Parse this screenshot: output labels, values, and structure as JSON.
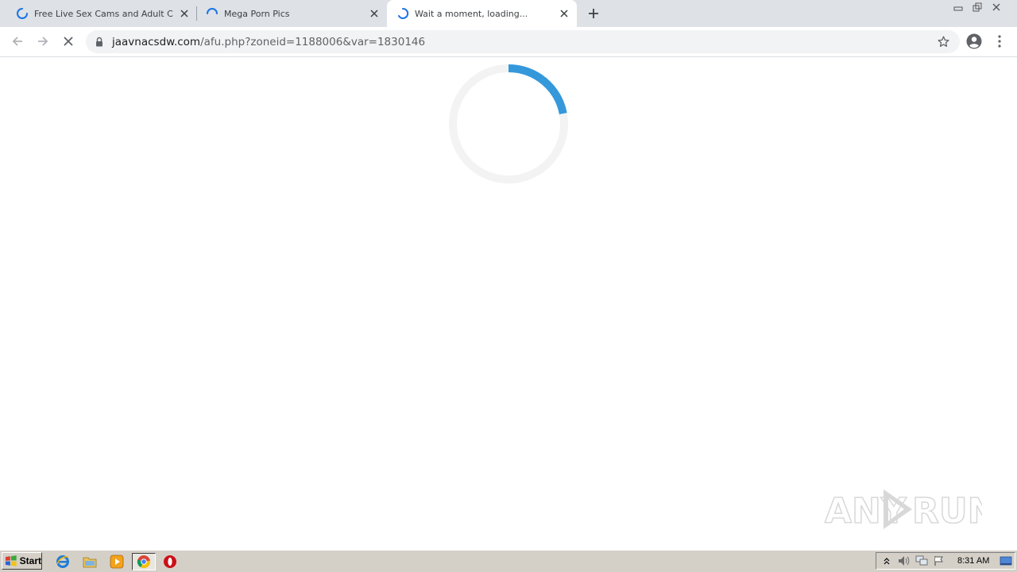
{
  "tabs": [
    {
      "title": "Free Live Sex Cams and Adult Chat ·",
      "state": "loading"
    },
    {
      "title": "Mega Porn Pics",
      "state": "loading"
    },
    {
      "title": "Wait a moment, loading...",
      "state": "loading",
      "active": true
    }
  ],
  "toolbar": {
    "url_host": "jaavnacsdw.com",
    "url_path": "/afu.php?zoneid=1188006&var=1830146",
    "back_icon": "arrow-left-icon",
    "forward_icon": "arrow-right-icon",
    "stop_icon": "close-icon",
    "lock_icon": "lock-icon",
    "bookmark_icon": "star-icon",
    "profile_icon": "account-circle-icon",
    "menu_icon": "more-vert-icon"
  },
  "page": {
    "loader_progress": 0.22,
    "loader_color": "#3498db",
    "loader_track_color": "#f3f3f3"
  },
  "watermark": {
    "text_left": "ANY",
    "text_right": "RUN"
  },
  "taskbar": {
    "start_label": "Start",
    "apps": [
      "internet-explorer-icon",
      "file-explorer-icon",
      "media-player-icon",
      "chrome-icon",
      "opera-icon"
    ],
    "clock": "8:31 AM"
  },
  "colors": {
    "tabstrip_bg": "#dee1e6",
    "accent_blue": "#1a73e8",
    "taskbar_bg": "#d4d0c8"
  }
}
